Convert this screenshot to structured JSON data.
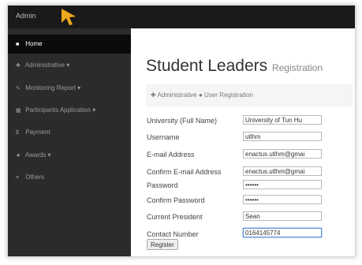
{
  "header": {
    "brand": "Admin"
  },
  "sidebar": {
    "items": [
      {
        "label": "Home",
        "icon": "home-icon",
        "glyph": "■"
      },
      {
        "label": "Administrative",
        "icon": "plus-icon",
        "glyph": "✚",
        "dropdown": true
      },
      {
        "label": "Monitoring Report",
        "icon": "pencil-icon",
        "glyph": "✎",
        "dropdown": true
      },
      {
        "label": "Participants Application",
        "icon": "grid-icon",
        "glyph": "▦",
        "dropdown": true
      },
      {
        "label": "Payment",
        "icon": "dollar-icon",
        "glyph": "$"
      },
      {
        "label": "Awards",
        "icon": "trophy-icon",
        "glyph": "★",
        "dropdown": true
      },
      {
        "label": "Others",
        "icon": "list-icon",
        "glyph": "≡"
      }
    ]
  },
  "page": {
    "title": "Student Leaders",
    "subtitle": "Registration"
  },
  "breadcrumb": {
    "first": "Administrative",
    "second": "User Registration"
  },
  "form": {
    "fields": [
      {
        "label": "University (Full Name)",
        "value": "University of Tun Hu"
      },
      {
        "label": "Username",
        "value": "utlhm"
      },
      {
        "label": "E-mail Address",
        "value": "enactus.utlhm@gmai"
      },
      {
        "label": "Confirm E-mail Address",
        "value": "enactus.utlhm@gmai"
      },
      {
        "label": "Password",
        "value": "••••••"
      },
      {
        "label": "Confirm Password",
        "value": "••••••"
      },
      {
        "label": "Current President",
        "value": "Sean"
      },
      {
        "label": "Contact Number",
        "value": "0164145774"
      }
    ],
    "submit_label": "Register"
  },
  "colors": {
    "topbar": "#1a1a1a",
    "sidebar": "#2b2b2b",
    "active": "#0b0b0b",
    "cursor": "#f0a81c"
  }
}
